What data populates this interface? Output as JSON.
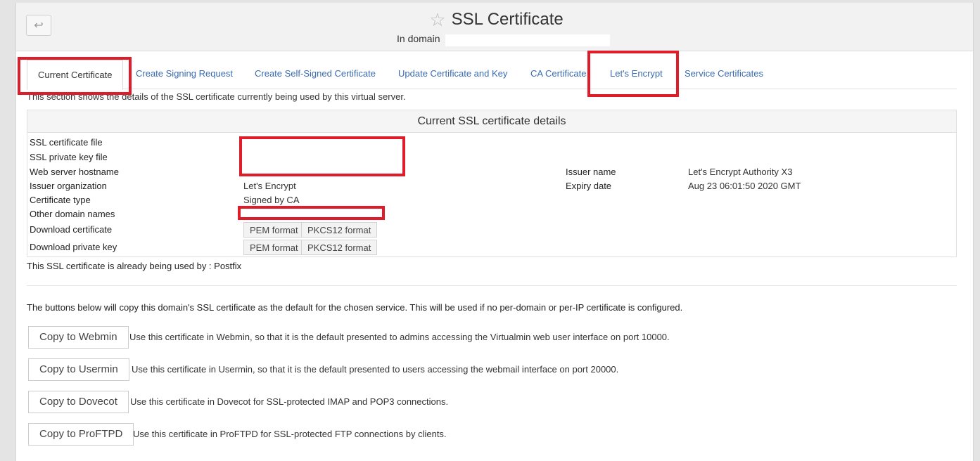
{
  "header": {
    "back_label": "↩",
    "title": "SSL Certificate",
    "domain_prefix": "In domain",
    "star_icon": "star-outline-icon"
  },
  "tabs": [
    {
      "label": "Current Certificate",
      "active": true
    },
    {
      "label": "Create Signing Request"
    },
    {
      "label": "Create Self-Signed Certificate"
    },
    {
      "label": "Update Certificate and Key"
    },
    {
      "label": "CA Certificate"
    },
    {
      "label": "Let's Encrypt"
    },
    {
      "label": "Service Certificates"
    }
  ],
  "intro": "This section shows the details of the SSL certificate currently being used by this virtual server.",
  "cert": {
    "title": "Current SSL certificate details",
    "rows": {
      "cert_file": "SSL certificate file",
      "key_file": "SSL private key file",
      "hostname": "Web server hostname",
      "issuer_org": "Issuer organization",
      "issuer_org_value": "Let's Encrypt",
      "cert_type": "Certificate type",
      "cert_type_value": "Signed by CA",
      "other_names": "Other domain names",
      "download_cert": "Download certificate",
      "download_key": "Download private key",
      "issuer_name": "Issuer name",
      "issuer_name_value": "Let's Encrypt Authority X3",
      "expiry": "Expiry date",
      "expiry_value": "Aug 23 06:01:50 2020 GMT"
    },
    "pem": "PEM format",
    "pkcs12": "PKCS12 format"
  },
  "used_by": "This SSL certificate is already being used by : Postfix",
  "copy_intro": "The buttons below will copy this domain's SSL certificate as the default for the chosen service. This will be used if no per-domain or per-IP certificate is configured.",
  "copy": [
    {
      "button": "Copy to Webmin",
      "desc": "Use this certificate in Webmin, so that it is the default presented to admins accessing the Virtualmin web user interface on port 10000."
    },
    {
      "button": "Copy to Usermin",
      "desc": "Use this certificate in Usermin, so that it is the default presented to users accessing the webmail interface on port 20000."
    },
    {
      "button": "Copy to Dovecot",
      "desc": "Use this certificate in Dovecot for SSL-protected IMAP and POP3 connections."
    },
    {
      "button": "Copy to ProFTPD",
      "desc": "Use this certificate in ProFTPD for SSL-protected FTP connections by clients."
    }
  ],
  "colors": {
    "highlight": "#e11c2a",
    "link": "#3a6bb0"
  }
}
